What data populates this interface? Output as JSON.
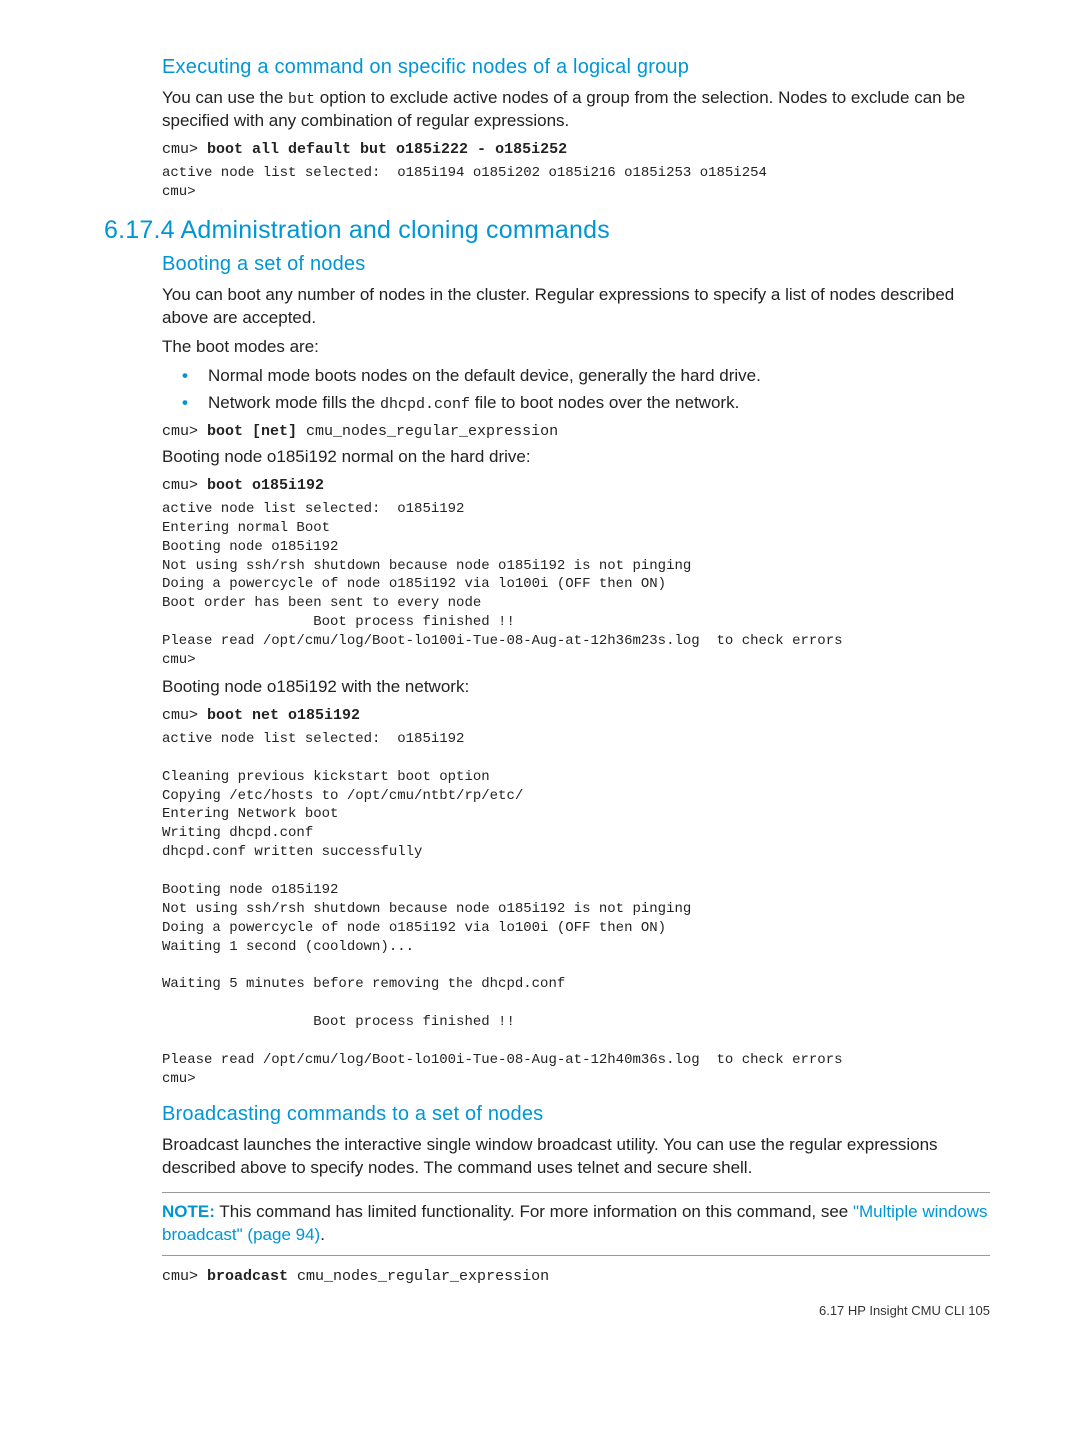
{
  "sec_exec": {
    "heading": "Executing a command on specific nodes of a logical group",
    "p1_a": "You can use the ",
    "p1_code": "but",
    "p1_b": " option to exclude active nodes of a group from the selection. Nodes to exclude can be specified with any combination of regular expressions.",
    "cmd_prompt": "cmu> ",
    "cmd_bold": "boot all default but o185i222 - o185i252",
    "out": "active node list selected:  o185i194 o185i202 o185i216 o185i253 o185i254\ncmu>"
  },
  "sec_admin": {
    "heading": "6.17.4 Administration and cloning commands"
  },
  "sec_boot": {
    "heading": "Booting a set of nodes",
    "p1": "You can boot any number of nodes in the cluster. Regular expressions to specify a list of nodes described above are accepted.",
    "p2": "The boot modes are:",
    "bullets": {
      "b1": "Normal mode boots nodes on the default device, generally the hard drive.",
      "b2_a": "Network mode fills the ",
      "b2_code": "dhcpd.conf",
      "b2_b": " file to boot nodes over the network."
    },
    "cmd1_prompt": "cmu> ",
    "cmd1_bold": "boot [net]",
    "cmd1_tail": " cmu_nodes_regular_expression",
    "p3": "Booting node o185i192 normal on the hard drive:",
    "cmd2_prompt": "cmu> ",
    "cmd2_bold": "boot o185i192",
    "out1": "active node list selected:  o185i192\nEntering normal Boot\nBooting node o185i192\nNot using ssh/rsh shutdown because node o185i192 is not pinging\nDoing a powercycle of node o185i192 via lo100i (OFF then ON)\nBoot order has been sent to every node\n                  Boot process finished !!\nPlease read /opt/cmu/log/Boot-lo100i-Tue-08-Aug-at-12h36m23s.log  to check errors\ncmu>",
    "p4": "Booting node o185i192 with the network:",
    "cmd3_prompt": "cmu> ",
    "cmd3_bold": "boot net o185i192",
    "out2": "active node list selected:  o185i192\n\nCleaning previous kickstart boot option\nCopying /etc/hosts to /opt/cmu/ntbt/rp/etc/\nEntering Network boot\nWriting dhcpd.conf\ndhcpd.conf written successfully\n\nBooting node o185i192\nNot using ssh/rsh shutdown because node o185i192 is not pinging\nDoing a powercycle of node o185i192 via lo100i (OFF then ON)\nWaiting 1 second (cooldown)...\n\nWaiting 5 minutes before removing the dhcpd.conf\n\n                  Boot process finished !!\n\nPlease read /opt/cmu/log/Boot-lo100i-Tue-08-Aug-at-12h40m36s.log  to check errors\ncmu>"
  },
  "sec_broadcast": {
    "heading": "Broadcasting commands to a set of nodes",
    "p1": "Broadcast launches the interactive single window broadcast utility. You can use the regular expressions described above to specify nodes. The command uses telnet and secure shell.",
    "note_label": "NOTE:",
    "note_text_a": "   This command has limited functionality. For more information on this command, see ",
    "note_link": "\"Multiple windows broadcast\" (page 94)",
    "note_text_b": ".",
    "cmd_prompt": "cmu> ",
    "cmd_bold": "broadcast",
    "cmd_tail": " cmu_nodes_regular_expression"
  },
  "footer": "6.17 HP Insight CMU CLI   105"
}
